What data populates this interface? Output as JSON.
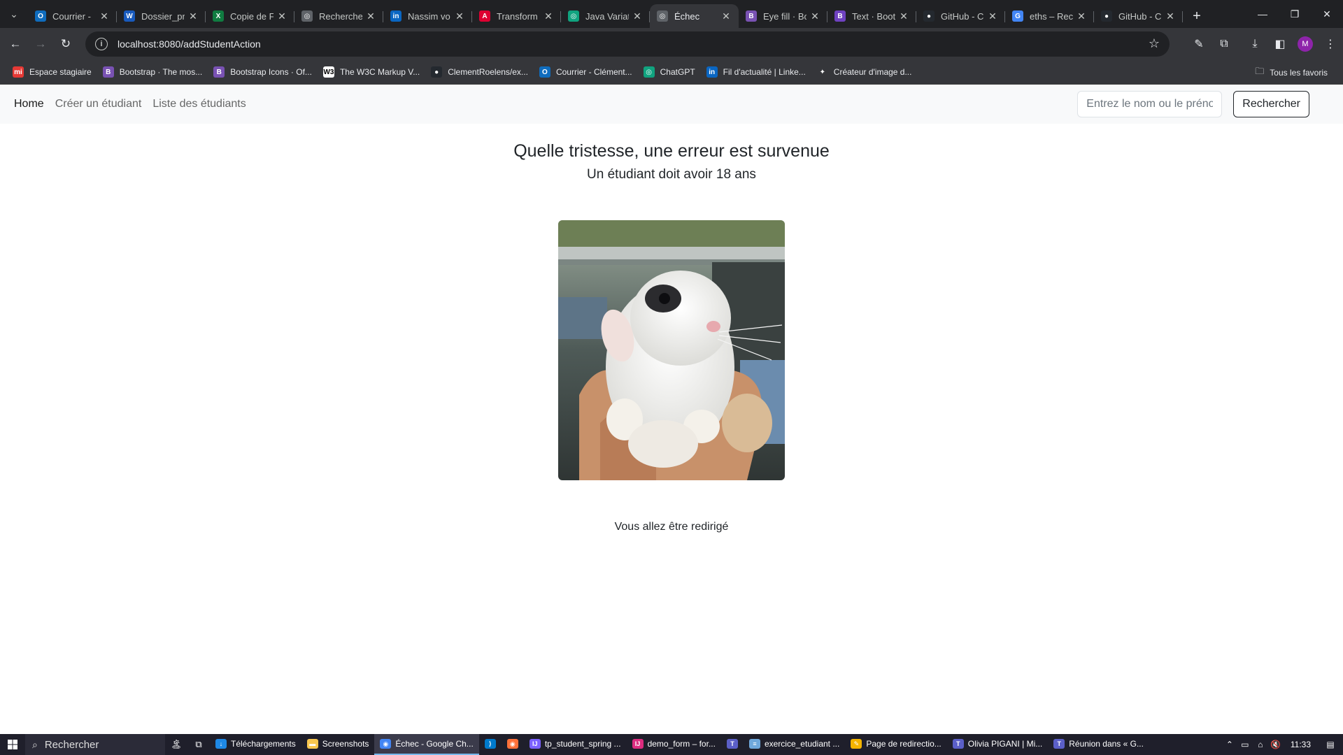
{
  "browser": {
    "tabs": [
      {
        "title": "Courrier - ",
        "icon": "outlook-icon",
        "color": "#0f6cbd",
        "glyph": "O"
      },
      {
        "title": "Dossier_pr",
        "icon": "word-icon",
        "color": "#185abd",
        "glyph": "W"
      },
      {
        "title": "Copie de F",
        "icon": "excel-icon",
        "color": "#107c41",
        "glyph": "X"
      },
      {
        "title": "Recherche",
        "icon": "globe-icon",
        "color": "#5f6368",
        "glyph": "◎"
      },
      {
        "title": "Nassim vo",
        "icon": "linkedin-icon",
        "color": "#0a66c2",
        "glyph": "in"
      },
      {
        "title": "Transform",
        "icon": "angular-icon",
        "color": "#dd0031",
        "glyph": "A"
      },
      {
        "title": "Java Variat",
        "icon": "chatgpt-icon",
        "color": "#10a37f",
        "glyph": "◎"
      },
      {
        "title": "Échec",
        "icon": "globe-icon",
        "color": "#5f6368",
        "glyph": "◎"
      },
      {
        "title": "Eye fill · Bo",
        "icon": "bootstrap-icon",
        "color": "#7952b3",
        "glyph": "B"
      },
      {
        "title": "Text · Boot",
        "icon": "bootstrap-icon",
        "color": "#6f42c1",
        "glyph": "B"
      },
      {
        "title": "GitHub - C",
        "icon": "github-icon",
        "color": "#24292f",
        "glyph": "●"
      },
      {
        "title": "eths – Rec",
        "icon": "google-icon",
        "color": "#4285f4",
        "glyph": "G"
      },
      {
        "title": "GitHub - C",
        "icon": "github-icon",
        "color": "#24292f",
        "glyph": "●"
      }
    ],
    "url": "localhost:8080/addStudentAction",
    "profile_initial": "M",
    "bookmarks": [
      {
        "label": "Espace stagiaire",
        "icon": "mi-icon",
        "color": "#e53935",
        "glyph": "mi"
      },
      {
        "label": "Bootstrap · The mos...",
        "icon": "bootstrap-icon",
        "color": "#7952b3",
        "glyph": "B"
      },
      {
        "label": "Bootstrap Icons · Of...",
        "icon": "bootstrap-icon",
        "color": "#7952b3",
        "glyph": "B"
      },
      {
        "label": "The W3C Markup V...",
        "icon": "w3c-icon",
        "color": "#ffffff",
        "glyph": "W3"
      },
      {
        "label": "ClementRoelens/ex...",
        "icon": "github-icon",
        "color": "#24292f",
        "glyph": "●"
      },
      {
        "label": "Courrier - Clément...",
        "icon": "outlook-icon",
        "color": "#0f6cbd",
        "glyph": "O"
      },
      {
        "label": "ChatGPT",
        "icon": "chatgpt-icon",
        "color": "#10a37f",
        "glyph": "◎"
      },
      {
        "label": "Fil d'actualité | Linke...",
        "icon": "linkedin-icon",
        "color": "#0a66c2",
        "glyph": "in"
      },
      {
        "label": "Créateur d'image d...",
        "icon": "bing-icon",
        "color": "#35363a",
        "glyph": "✦"
      }
    ],
    "all_bookmarks_label": "Tous les favoris"
  },
  "navbar": {
    "home": "Home",
    "create": "Créer un étudiant",
    "list": "Liste des étudiants",
    "search_placeholder": "Entrez le nom ou le prénom",
    "search_button": "Rechercher"
  },
  "main": {
    "title": "Quelle tristesse, une erreur est survenue",
    "subtitle": "Un étudiant doit avoir 18 ans",
    "redirect_text": "Vous allez être redirigé"
  },
  "taskbar": {
    "search_label": "Rechercher",
    "apps": [
      {
        "label": "Téléchargements",
        "icon": "download-folder-icon",
        "color": "#1e88e5",
        "glyph": "↓",
        "active": false
      },
      {
        "label": "Screenshots",
        "icon": "folder-icon",
        "color": "#f9c74f",
        "glyph": "▬",
        "active": false
      },
      {
        "label": "Échec - Google Ch...",
        "icon": "chrome-icon",
        "color": "#4285f4",
        "glyph": "◉",
        "active": true
      },
      {
        "label": "",
        "icon": "vscode-icon",
        "color": "#007acc",
        "glyph": "⟩",
        "active": false
      },
      {
        "label": "",
        "icon": "firefox-icon",
        "color": "#ff7139",
        "glyph": "◉",
        "active": false
      },
      {
        "label": "tp_student_spring ...",
        "icon": "intellij-icon",
        "color": "#7b61ff",
        "glyph": "IJ",
        "active": false
      },
      {
        "label": "demo_form – for...",
        "icon": "intellij-icon",
        "color": "#dd2c7f",
        "glyph": "IJ",
        "active": false
      },
      {
        "label": "",
        "icon": "teams-icon",
        "color": "#5b5fc7",
        "glyph": "T",
        "active": false
      },
      {
        "label": "exercice_etudiant ...",
        "icon": "notepad-icon",
        "color": "#6fa8dc",
        "glyph": "≡",
        "active": false
      },
      {
        "label": "Page de redirectio...",
        "icon": "paint-icon",
        "color": "#f4b400",
        "glyph": "✎",
        "active": false
      },
      {
        "label": "Olivia PIGANI | Mi...",
        "icon": "teams-icon",
        "color": "#5b5fc7",
        "glyph": "T",
        "active": false
      },
      {
        "label": "Réunion dans « G...",
        "icon": "teams-icon",
        "color": "#5b5fc7",
        "glyph": "T",
        "active": false
      }
    ],
    "time": "11:33"
  }
}
